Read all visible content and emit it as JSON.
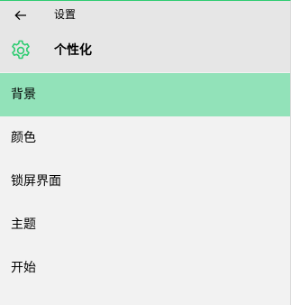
{
  "titlebar": {
    "title": "设置"
  },
  "header": {
    "title": "个性化",
    "icon": "gear-icon"
  },
  "nav": {
    "items": [
      {
        "label": "背景",
        "selected": true
      },
      {
        "label": "颜色",
        "selected": false
      },
      {
        "label": "锁屏界面",
        "selected": false
      },
      {
        "label": "主题",
        "selected": false
      },
      {
        "label": "开始",
        "selected": false
      }
    ]
  },
  "colors": {
    "accent": "#2ecc71",
    "selected_bg": "#92e2b9",
    "header_bg": "#e6e6e6",
    "content_bg": "#f2f2f2"
  }
}
